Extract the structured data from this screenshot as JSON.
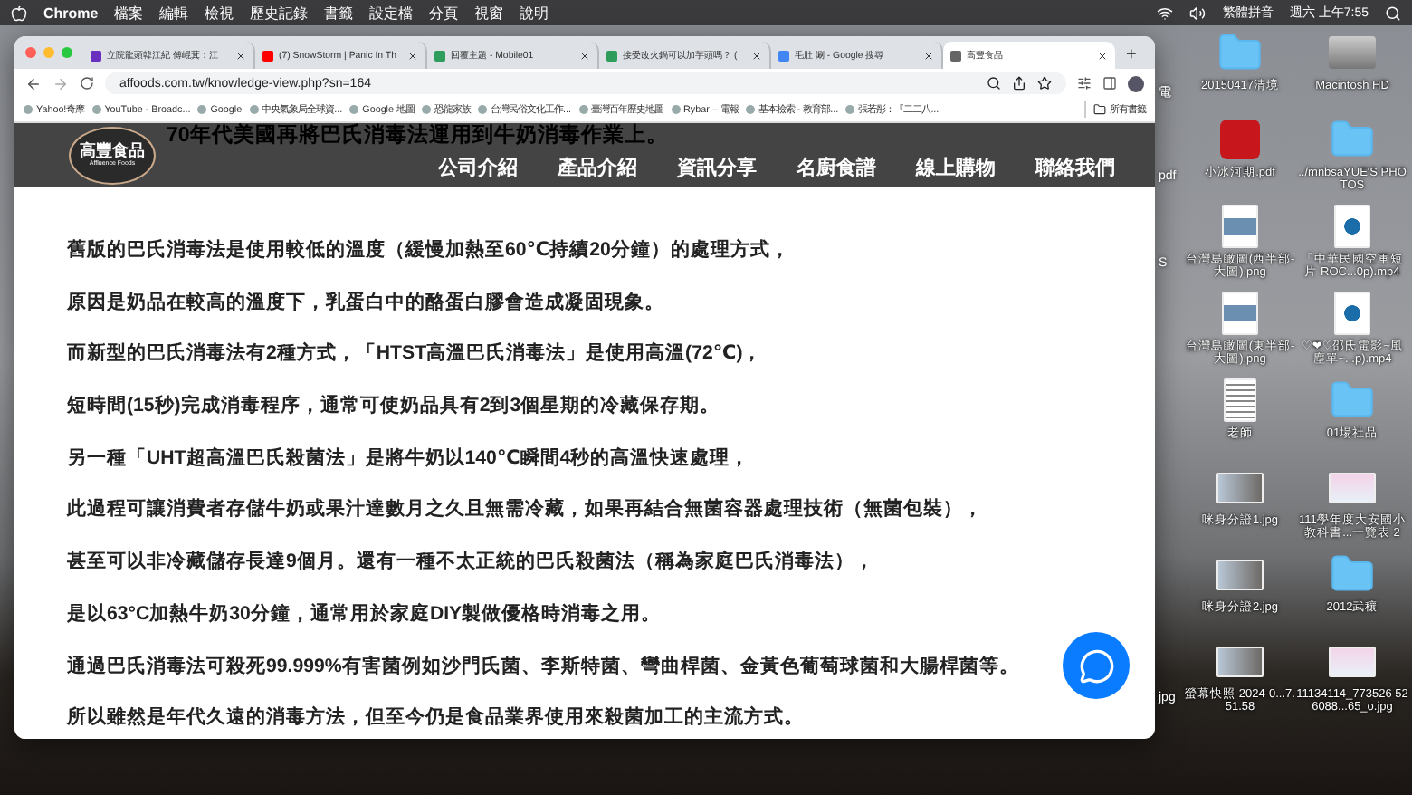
{
  "menu_bar": {
    "app": "Chrome",
    "items": [
      "檔案",
      "編輯",
      "檢視",
      "歷史記錄",
      "書籤",
      "設定檔",
      "分頁",
      "視窗",
      "說明"
    ],
    "input_method": "繁體拼音",
    "clock": "週六 上午7:55"
  },
  "browser": {
    "tabs": [
      {
        "title": "立院龍頭韓江紀 傅崐萁：江",
        "color": "#6b2fbf",
        "selected": false
      },
      {
        "title": "(7) SnowStorm | Panic In Th",
        "color": "#ff0000",
        "selected": false
      },
      {
        "title": "回覆主題 - Mobile01",
        "color": "#2e9c5a",
        "selected": false
      },
      {
        "title": "接受改火鍋可以加芋頭嗎？ (",
        "color": "#2e9c5a",
        "selected": false
      },
      {
        "title": "毛肚 涮 - Google 搜尋",
        "color": "#4285f4",
        "selected": false
      },
      {
        "title": "高豐食品",
        "color": "#666666",
        "selected": true
      }
    ],
    "new_tab": "+",
    "address": "affoods.com.tw/knowledge-view.php?sn=164",
    "bookmarks": [
      "Yahoo!奇摩",
      "YouTube - Broadc...",
      "Google",
      "中央氣象局全球資...",
      "Google 地圖",
      "恐龍家族",
      "台灣民俗文化工作...",
      "臺灣百年歷史地圖",
      "Rybar – 電報",
      "基本檢索 - 教育部...",
      "張若彤：『二二八..."
    ],
    "all_bookmarks": "所有書籤"
  },
  "site": {
    "logo": {
      "name": "高豐食品",
      "tagline": "Affluence Foods"
    },
    "scrolled_line": "70年代美國再將巴氏消毒法運用到牛奶消毒作業上。",
    "nav": [
      "公司介紹",
      "產品介紹",
      "資訊分享",
      "名廚食譜",
      "線上購物",
      "聯絡我們"
    ],
    "paragraphs": [
      "舊版的巴氏消毒法是使用較低的溫度（緩慢加熱至60℃持續20分鐘）的處理方式，",
      "原因是奶品在較高的溫度下，乳蛋白中的酪蛋白膠會造成凝固現象。",
      "而新型的巴氏消毒法有2種方式，「HTST高溫巴氏消毒法」是使用高溫(72℃)，",
      "短時間(15秒)完成消毒程序，通常可使奶品具有2到3個星期的冷藏保存期。",
      "另一種「UHT超高溫巴氏殺菌法」是將牛奶以140℃瞬間4秒的高溫快速處理，",
      "此過程可讓消費者存儲牛奶或果汁達數月之久且無需冷藏，如果再結合無菌容器處理技術（無菌包裝），",
      "甚至可以非冷藏儲存長達9個月。還有一種不太正統的巴氏殺菌法（稱為家庭巴氏消毒法），",
      "是以63°C加熱牛奶30分鐘，通常用於家庭DIY製做優格時消毒之用。",
      "通過巴氏消毒法可殺死99.999%有害菌例如沙門氏菌、李斯特菌、彎曲桿菌、金黃色葡萄球菌和大腸桿菌等。",
      "所以雖然是年代久遠的消毒方法，但至今仍是食品業界使用來殺菌加工的主流方式。"
    ]
  },
  "desktop": {
    "partial_labels": [
      "電",
      "pdf",
      "S",
      "jpg"
    ],
    "items": [
      {
        "label": "20150417清境",
        "kind": "folder"
      },
      {
        "label": "Macintosh HD",
        "kind": "drive"
      },
      {
        "label": "小冰河期.pdf",
        "kind": "pdf"
      },
      {
        "label": "../mnbsaYUE'S PHOTOS",
        "kind": "folder"
      },
      {
        "label": "台灣島瞰圖(西半部-大圖).png",
        "kind": "image"
      },
      {
        "label": "「中華民國空軍短片 ROC...0p).mp4",
        "kind": "video"
      },
      {
        "label": "台灣島瞰圖(東半部-大圖).png",
        "kind": "image"
      },
      {
        "label": "♡❤♡邵氏電影~風塵單~...p).mp4",
        "kind": "video"
      },
      {
        "label": "老師",
        "kind": "doc"
      },
      {
        "label": "01場社品",
        "kind": "folder"
      },
      {
        "label": "咪身分證1.jpg",
        "kind": "photo"
      },
      {
        "label": "111學年度大安國小教科書...一覽表 2",
        "kind": "sheet"
      },
      {
        "label": "咪身分證2.jpg",
        "kind": "photo"
      },
      {
        "label": "2012武穰",
        "kind": "folder"
      },
      {
        "label": "螢幕快照 2024-0...7.51.58",
        "kind": "photo"
      },
      {
        "label": "11134114_773526 526088...65_o.jpg",
        "kind": "sheet"
      }
    ]
  }
}
